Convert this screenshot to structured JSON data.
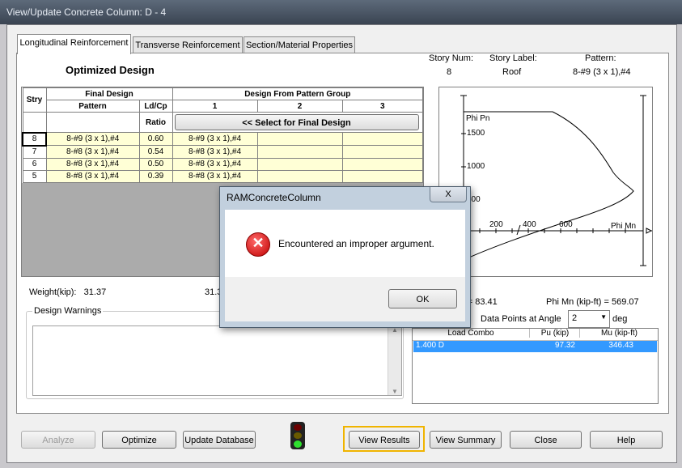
{
  "window": {
    "title": "View/Update Concrete Column:  D - 4"
  },
  "tabs": [
    "Longitudinal Reinforcement",
    "Transverse Reinforcement",
    "Section/Material Properties"
  ],
  "heading": "Optimized Design",
  "story_info": {
    "labels": [
      "Story Num:",
      "Story Label:",
      "Pattern:"
    ],
    "values": [
      "8",
      "Roof",
      "8-#9 (3 x 1),#4"
    ]
  },
  "table": {
    "headers": {
      "stry": "Stry",
      "final_design": "Final Design",
      "pattern_group": "Design From Pattern Group",
      "pattern": "Pattern",
      "ldcp": "Ld/Cp",
      "ratio": "Ratio",
      "col1": "1",
      "col2": "2",
      "col3": "3"
    },
    "select_button": "<< Select for Final Design",
    "rows": [
      {
        "stry": "8",
        "pattern": "8-#9 (3 x 1),#4",
        "ratio": "0.60",
        "c1": "8-#9 (3 x 1),#4"
      },
      {
        "stry": "7",
        "pattern": "8-#8 (3 x 1),#4",
        "ratio": "0.54",
        "c1": "8-#8 (3 x 1),#4"
      },
      {
        "stry": "6",
        "pattern": "8-#8 (3 x 1),#4",
        "ratio": "0.50",
        "c1": "8-#8 (3 x 1),#4"
      },
      {
        "stry": "5",
        "pattern": "8-#8 (3 x 1),#4",
        "ratio": "0.39",
        "c1": "8-#8 (3 x 1),#4"
      }
    ]
  },
  "weight": {
    "label": "Weight(kip):",
    "value": "31.37",
    "value2": "31.3"
  },
  "warnings": {
    "label": "Design Warnings"
  },
  "plot": {
    "y_label": "Phi Pn",
    "x_label": "Phi Mn",
    "y_ticks": [
      "1500",
      "1000",
      "500"
    ],
    "x_ticks": [
      "200",
      "400",
      "600"
    ]
  },
  "phi_readout": {
    "pn": "kip) = 83.41",
    "mn": "Phi Mn (kip-ft) = 569.07"
  },
  "angle": {
    "label": "Data Points at Angle",
    "value": "2",
    "unit": "deg"
  },
  "load_table": {
    "headers": [
      "Load Combo",
      "Pu (kip)",
      "Mu (kip-ft)"
    ],
    "rows": [
      {
        "combo": "1.400 D",
        "pu": "97.32",
        "mu": "346.43"
      }
    ]
  },
  "buttons": {
    "analyze": "Analyze",
    "optimize": "Optimize",
    "update_db": "Update Database",
    "view_results": "View Results",
    "view_summary": "View Summary",
    "close": "Close",
    "help": "Help"
  },
  "dialog": {
    "title": "RAMConcreteColumn",
    "message": "Encountered an improper argument.",
    "ok": "OK",
    "close": "X"
  },
  "colors": {
    "accent": "#f0b400",
    "selection": "#3399ff",
    "row_highlight": "#ffffd6"
  }
}
